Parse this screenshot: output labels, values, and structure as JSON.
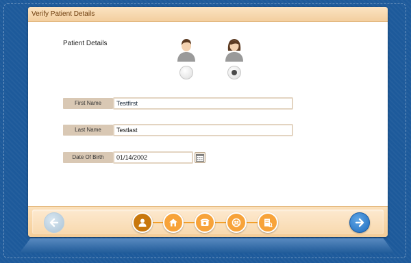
{
  "window": {
    "title": "Verify Patient Details"
  },
  "patient": {
    "section_label": "Patient Details",
    "gender_options": [
      {
        "name": "male",
        "icon": "male-avatar-icon",
        "selected": false
      },
      {
        "name": "female",
        "icon": "female-avatar-icon",
        "selected": true
      }
    ],
    "first_name": {
      "label": "First Name",
      "value": "Testfirst"
    },
    "last_name": {
      "label": "Last Name",
      "value": "Testlast"
    },
    "dob": {
      "label": "Date Of Birth",
      "value": "01/14/2002",
      "icon": "calendar-icon"
    }
  },
  "navigation": {
    "prev_icon": "arrow-left-icon",
    "next_icon": "arrow-right-icon",
    "steps": [
      {
        "icon": "person-icon",
        "state": "active"
      },
      {
        "icon": "house-icon",
        "state": "inactive"
      },
      {
        "icon": "phone-icon",
        "state": "inactive"
      },
      {
        "icon": "insurance-icon",
        "state": "inactive"
      },
      {
        "icon": "document-icon",
        "state": "inactive"
      }
    ]
  },
  "colors": {
    "background": "#1d5a9b",
    "accent_orange": "#f7a33a",
    "active_step": "#c8780e",
    "label_bg": "#d9c8b4",
    "next_button": "#1e6bbd"
  }
}
